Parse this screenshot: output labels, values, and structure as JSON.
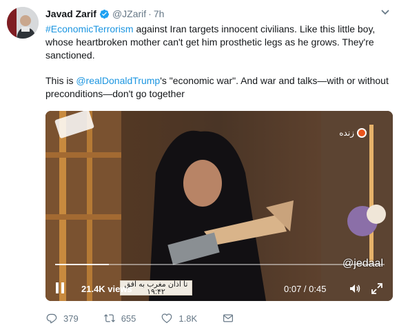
{
  "tweet": {
    "author": {
      "name": "Javad Zarif",
      "handle": "@JZarif",
      "separator": "·",
      "time": "7h",
      "verified": true
    },
    "body": {
      "p1_hashtag": "#EconomicTerrorism",
      "p1_text": " against Iran targets innocent civilians. Like this little boy, whose heartbroken mother can't get him prosthetic legs as he grows. They're sanctioned.",
      "p2_prefix": "This is ",
      "p2_mention": "@realDonaldTrump",
      "p2_text": "'s \"economic war\". And war and talks—with or without preconditions—don't go together"
    },
    "media": {
      "live_label": "زنده",
      "watermark": "@jedaal",
      "views": "21.4K views",
      "timecode": "0:07 / 0:45",
      "progress_fraction": 0.164,
      "tv_caption_line1": "تا اذان مغرب به افق",
      "tv_caption_line2": "۱۹:۴۲"
    },
    "actions": {
      "replies": "379",
      "retweets": "655",
      "likes": "1.8K"
    }
  },
  "colors": {
    "link": "#1b95e0",
    "verified": "#1da1f2",
    "meta": "#657786"
  },
  "icons": [
    "verified-badge-icon",
    "caret-down-icon",
    "pause-icon",
    "volume-icon",
    "expand-icon",
    "reply-icon",
    "retweet-icon",
    "like-icon",
    "message-icon"
  ]
}
